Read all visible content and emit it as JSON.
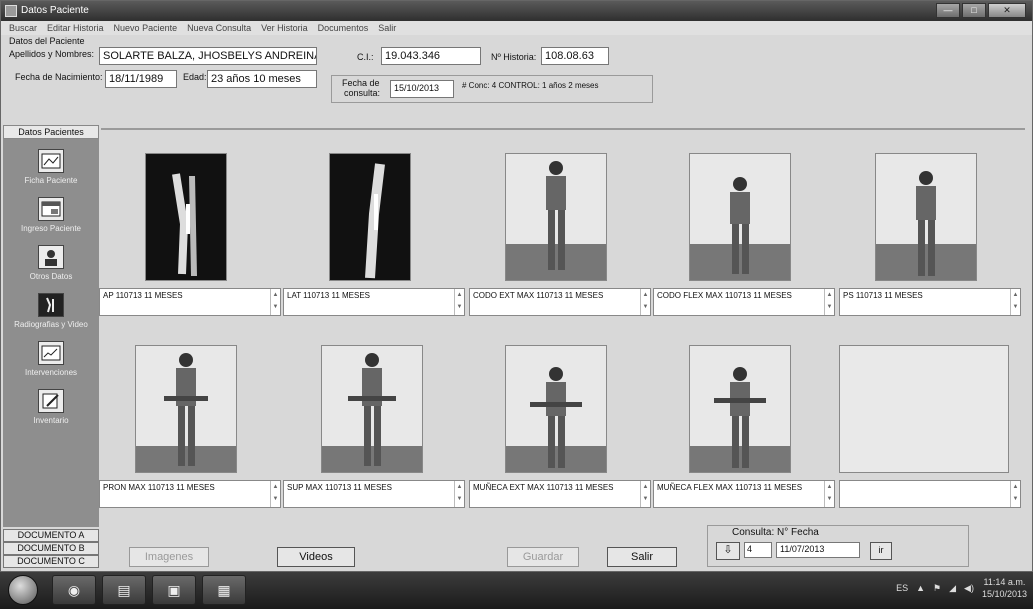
{
  "window": {
    "title": "Datos Paciente"
  },
  "menu": [
    "Buscar",
    "Editar Historia",
    "Nuevo Paciente",
    "Nueva Consulta",
    "Ver Historia",
    "Documentos",
    "Salir"
  ],
  "patient": {
    "caption": "Datos del Paciente",
    "name_label": "Apellidos y Nombres:",
    "name": "SOLARTE BALZA, JHOSBELYS ANDREINA",
    "ci_label": "C.I.:",
    "ci": "19.043.346",
    "historia_label": "Nº Historia:",
    "historia": "108.08.63",
    "birth_label": "Fecha de Nacimiento:",
    "birth": "18/11/1989",
    "age_label": "Edad:",
    "age": "23 años 10 meses",
    "consult_date_label_1": "Fecha de",
    "consult_date_label_2": "consulta:",
    "consult_date": "15/10/2013",
    "consult_info": "# Conc: 4  CONTROL: 1 años 2 meses"
  },
  "sidebar": {
    "header": "Datos Pacientes",
    "items": [
      {
        "label": "Ficha Paciente",
        "icon": "id-card-icon"
      },
      {
        "label": "Ingreso Paciente",
        "icon": "window-icon"
      },
      {
        "label": "Otros Datos",
        "icon": "person-icon"
      },
      {
        "label": "Radiografias y Video",
        "icon": "xray-icon"
      },
      {
        "label": "Intervenciones",
        "icon": "chart-icon"
      },
      {
        "label": "Inventario",
        "icon": "edit-icon"
      }
    ],
    "documents": [
      "DOCUMENTO A",
      "DOCUMENTO B",
      "DOCUMENTO C"
    ]
  },
  "gallery": {
    "row1": [
      {
        "caption": "AP 110713 11 MESES"
      },
      {
        "caption": "LAT 110713 11 MESES"
      },
      {
        "caption": "CODO EXT MAX 110713 11 MESES"
      },
      {
        "caption": "CODO FLEX MAX 110713 11 MESES"
      },
      {
        "caption": "PS 110713 11 MESES"
      }
    ],
    "row2": [
      {
        "caption": "PRON MAX 110713 11 MESES"
      },
      {
        "caption": "SUP MAX 110713 11 MESES"
      },
      {
        "caption": "MUÑECA EXT MAX 110713 11 MESES"
      },
      {
        "caption": "MUÑECA FLEX MAX 110713 11 MESES"
      },
      {
        "caption": ""
      }
    ]
  },
  "actions": {
    "imagenes": "Imagenes",
    "videos": "Videos",
    "guardar": "Guardar",
    "salir": "Salir"
  },
  "consulta": {
    "label": "Consulta: N° Fecha",
    "number": "4",
    "date": "11/07/2013",
    "go": "ir"
  },
  "taskbar": {
    "lang": "ES",
    "time": "11:14 a.m.",
    "date": "15/10/2013"
  }
}
